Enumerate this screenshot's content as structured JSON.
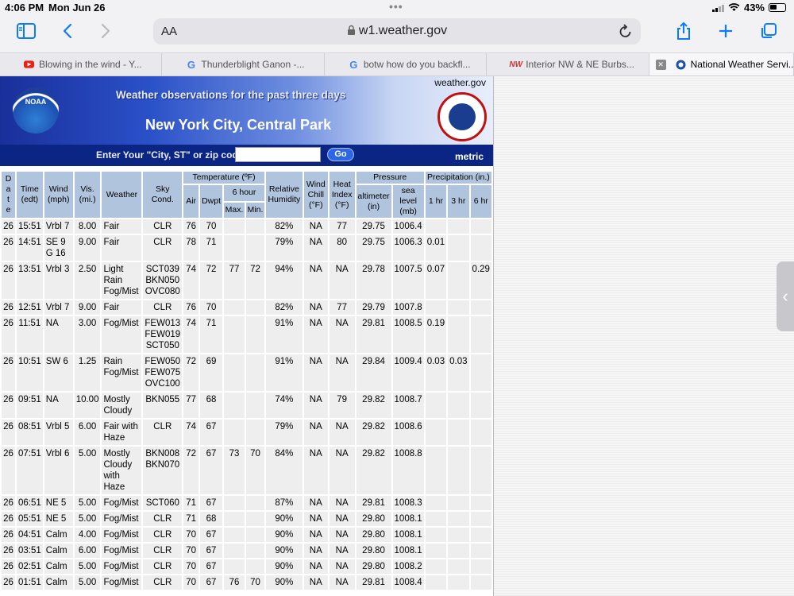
{
  "status": {
    "time": "4:06 PM",
    "date": "Mon Jun 26",
    "battery": "43%"
  },
  "browser": {
    "url": "w1.weather.gov",
    "aa_label": "AA",
    "tabs": [
      {
        "label": "Blowing in the wind - Y...",
        "icon": "youtube-icon"
      },
      {
        "label": "Thunderblight Ganon -...",
        "icon": "google-icon"
      },
      {
        "label": "botw how do you backfl...",
        "icon": "google-icon"
      },
      {
        "label": "Interior NW & NE Burbs...",
        "icon": "nw-icon"
      },
      {
        "label": "National Weather Servi...",
        "icon": "nws-icon",
        "active": true
      }
    ]
  },
  "page": {
    "site": "weather.gov",
    "subtitle": "Weather observations for the past three days",
    "city": "New York City, Central Park",
    "noaa_text": "NOAA",
    "search_label": "Enter Your \"City, ST\" or zip code",
    "go_label": "Go",
    "metric_label": "metric",
    "headers": {
      "date": "D a t e",
      "time": "Time (edt)",
      "wind": "Wind (mph)",
      "vis": "Vis. (mi.)",
      "weather": "Weather",
      "sky": "Sky Cond.",
      "temperature": "Temperature (ºF)",
      "air": "Air",
      "dwpt": "Dwpt",
      "six_hour": "6 hour",
      "max": "Max.",
      "min": "Min.",
      "humidity": "Relative Humidity",
      "wind_chill": "Wind Chill (°F)",
      "heat_index": "Heat Index (°F)",
      "pressure": "Pressure",
      "altimeter": "altimeter (in)",
      "sea_level": "sea level (mb)",
      "precip": "Precipitation (in.)",
      "p1": "1 hr",
      "p3": "3 hr",
      "p6": "6 hr"
    },
    "rows": [
      [
        "26",
        "15:51",
        "Vrbl 7",
        "8.00",
        "Fair",
        "CLR",
        "76",
        "70",
        "",
        "",
        "82%",
        "NA",
        "77",
        "29.75",
        "1006.4",
        "",
        "",
        ""
      ],
      [
        "26",
        "14:51",
        "SE 9 G 16",
        "9.00",
        "Fair",
        "CLR",
        "78",
        "71",
        "",
        "",
        "79%",
        "NA",
        "80",
        "29.75",
        "1006.3",
        "0.01",
        "",
        ""
      ],
      [
        "26",
        "13:51",
        "Vrbl 3",
        "2.50",
        "Light Rain Fog/Mist",
        "SCT039 BKN050 OVC080",
        "74",
        "72",
        "77",
        "72",
        "94%",
        "NA",
        "NA",
        "29.78",
        "1007.5",
        "0.07",
        "",
        "0.29"
      ],
      [
        "26",
        "12:51",
        "Vrbl 7",
        "9.00",
        "Fair",
        "CLR",
        "76",
        "70",
        "",
        "",
        "82%",
        "NA",
        "77",
        "29.79",
        "1007.8",
        "",
        "",
        ""
      ],
      [
        "26",
        "11:51",
        "NA",
        "3.00",
        "Fog/Mist",
        "FEW013 FEW019 SCT050",
        "74",
        "71",
        "",
        "",
        "91%",
        "NA",
        "NA",
        "29.81",
        "1008.5",
        "0.19",
        "",
        ""
      ],
      [
        "26",
        "10:51",
        "SW 6",
        "1.25",
        "Rain Fog/Mist",
        "FEW050 FEW075 OVC100",
        "72",
        "69",
        "",
        "",
        "91%",
        "NA",
        "NA",
        "29.84",
        "1009.4",
        "0.03",
        "0.03",
        ""
      ],
      [
        "26",
        "09:51",
        "NA",
        "10.00",
        "Mostly Cloudy",
        "BKN055",
        "77",
        "68",
        "",
        "",
        "74%",
        "NA",
        "79",
        "29.82",
        "1008.7",
        "",
        "",
        ""
      ],
      [
        "26",
        "08:51",
        "Vrbl 5",
        "6.00",
        "Fair with Haze",
        "CLR",
        "74",
        "67",
        "",
        "",
        "79%",
        "NA",
        "NA",
        "29.82",
        "1008.6",
        "",
        "",
        ""
      ],
      [
        "26",
        "07:51",
        "Vrbl 6",
        "5.00",
        "Mostly Cloudy with Haze",
        "BKN008 BKN070",
        "72",
        "67",
        "73",
        "70",
        "84%",
        "NA",
        "NA",
        "29.82",
        "1008.8",
        "",
        "",
        ""
      ],
      [
        "26",
        "06:51",
        "NE 5",
        "5.00",
        "Fog/Mist",
        "SCT060",
        "71",
        "67",
        "",
        "",
        "87%",
        "NA",
        "NA",
        "29.81",
        "1008.3",
        "",
        "",
        ""
      ],
      [
        "26",
        "05:51",
        "NE 5",
        "5.00",
        "Fog/Mist",
        "CLR",
        "71",
        "68",
        "",
        "",
        "90%",
        "NA",
        "NA",
        "29.80",
        "1008.1",
        "",
        "",
        ""
      ],
      [
        "26",
        "04:51",
        "Calm",
        "4.00",
        "Fog/Mist",
        "CLR",
        "70",
        "67",
        "",
        "",
        "90%",
        "NA",
        "NA",
        "29.80",
        "1008.1",
        "",
        "",
        ""
      ],
      [
        "26",
        "03:51",
        "Calm",
        "6.00",
        "Fog/Mist",
        "CLR",
        "70",
        "67",
        "",
        "",
        "90%",
        "NA",
        "NA",
        "29.80",
        "1008.1",
        "",
        "",
        ""
      ],
      [
        "26",
        "02:51",
        "Calm",
        "5.00",
        "Fog/Mist",
        "CLR",
        "70",
        "67",
        "",
        "",
        "90%",
        "NA",
        "NA",
        "29.80",
        "1008.2",
        "",
        "",
        ""
      ],
      [
        "26",
        "01:51",
        "Calm",
        "5.00",
        "Fog/Mist",
        "CLR",
        "70",
        "67",
        "76",
        "70",
        "90%",
        "NA",
        "NA",
        "29.81",
        "1008.4",
        "",
        "",
        ""
      ]
    ]
  }
}
